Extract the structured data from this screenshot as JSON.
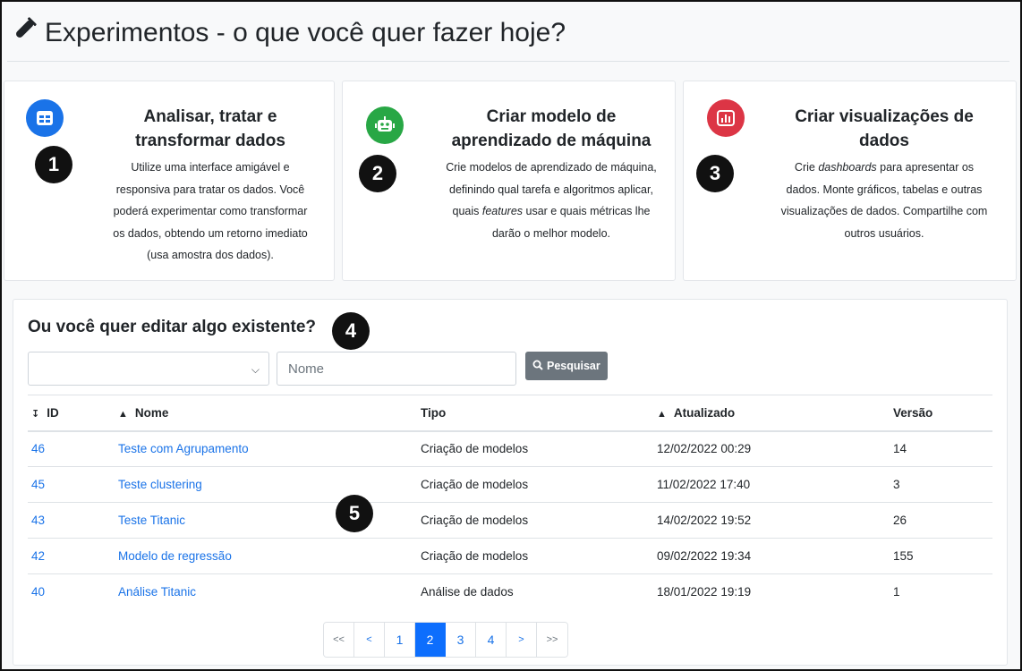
{
  "header": {
    "title": "Experimentos - o que você quer fazer hoje?",
    "icon": "test-tube-icon"
  },
  "cards": [
    {
      "number": "1",
      "icon": "table-icon",
      "color": "#1a73e8",
      "title_line1": "Analisar, tratar e",
      "title_line2": "transformar dados",
      "desc": [
        "Utilize uma interface amigável e",
        "responsiva para tratar os dados. Você",
        "poderá experimentar como transformar",
        "os dados, obtendo um retorno imediato",
        "(usa amostra dos dados)."
      ]
    },
    {
      "number": "2",
      "icon": "robot-icon",
      "color": "#28a745",
      "title_line1": "Criar modelo de",
      "title_line2": "aprendizado de máquina",
      "desc_l1": "Crie modelos de aprendizado de máquina,",
      "desc_l2": "definindo qual tarefa e algoritmos aplicar,",
      "desc_l3_a": "quais ",
      "desc_l3_em": "features",
      "desc_l3_b": " usar e quais métricas lhe",
      "desc_l4": "darão o melhor modelo."
    },
    {
      "number": "3",
      "icon": "bar-chart-icon",
      "color": "#dc3545",
      "title_line1": "Criar visualizações de",
      "title_line2": "dados",
      "desc_l1_a": "Crie ",
      "desc_l1_em": "dashboards",
      "desc_l1_b": " para apresentar os",
      "desc_l2": "dados. Monte gráficos, tabelas e outras",
      "desc_l3": "visualizações de dados. Compartilhe com",
      "desc_l4": "outros usuários."
    }
  ],
  "edit": {
    "title": "Ou você quer editar algo existente?",
    "number": "4",
    "select_value": "",
    "name_placeholder": "Nome",
    "search_label": "Pesquisar",
    "table_number": "5"
  },
  "table": {
    "headers": {
      "id": "ID",
      "nome": "Nome",
      "tipo": "Tipo",
      "atualizado": "Atualizado",
      "versao": "Versão"
    },
    "rows": [
      {
        "id": "46",
        "nome": "Teste com Agrupamento",
        "tipo": "Criação de modelos",
        "atualizado": "12/02/2022 00:29",
        "versao": "14"
      },
      {
        "id": "45",
        "nome": "Teste clustering",
        "tipo": "Criação de modelos",
        "atualizado": "11/02/2022 17:40",
        "versao": "3"
      },
      {
        "id": "43",
        "nome": "Teste Titanic",
        "tipo": "Criação de modelos",
        "atualizado": "14/02/2022 19:52",
        "versao": "26"
      },
      {
        "id": "42",
        "nome": "Modelo de regressão",
        "tipo": "Criação de modelos",
        "atualizado": "09/02/2022 19:34",
        "versao": "155"
      },
      {
        "id": "40",
        "nome": "Análise Titanic",
        "tipo": "Análise de dados",
        "atualizado": "18/01/2022 19:19",
        "versao": "1"
      }
    ]
  },
  "pagination": {
    "first": "<<",
    "prev": "<",
    "pages": [
      "1",
      "2",
      "3",
      "4"
    ],
    "active": "2",
    "next": ">",
    "last": ">>"
  }
}
